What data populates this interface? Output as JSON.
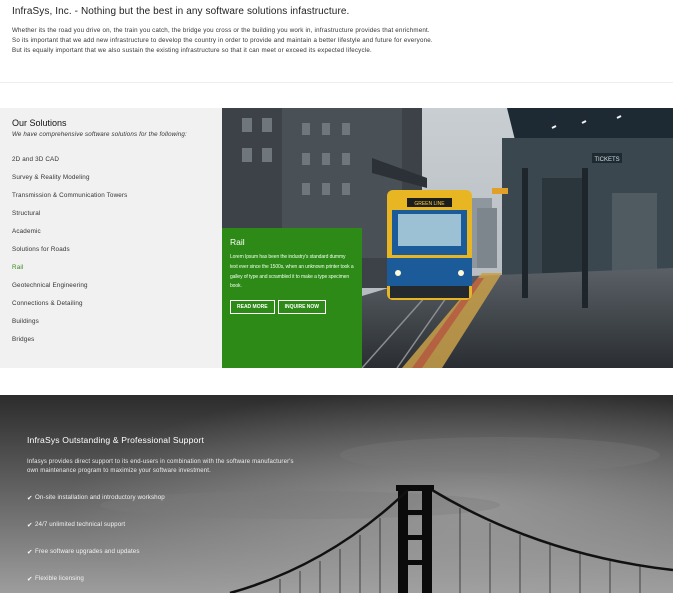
{
  "intro": {
    "title": "InfraSys, Inc. - Nothing but the best in any software solutions infastructure.",
    "lines": [
      "Whether its the road you drive on, the train you catch, the bridge you cross or the building you work in, infrastructure provides that enrichment.",
      "So its important that we add new infrastructure to develop the country in order to provide and maintain a better lifestyle and future for everyone.",
      "But its equally important that we also sustain the existing infrastructure so that it can meet or exceed its expected lifecycle."
    ]
  },
  "solutions": {
    "title": "Our Solutions",
    "subtitle": "We have comprehensive software solutions for the following:",
    "items": [
      {
        "label": "2D and 3D CAD"
      },
      {
        "label": "Survey & Reality Modeling"
      },
      {
        "label": "Transmission & Communication Towers"
      },
      {
        "label": "Structural"
      },
      {
        "label": "Academic"
      },
      {
        "label": "Solutions for Roads"
      },
      {
        "label": "Rail"
      },
      {
        "label": "Geotechnical Engineering"
      },
      {
        "label": "Connections & Detailing"
      },
      {
        "label": "Buildings"
      },
      {
        "label": "Bridges"
      }
    ],
    "active_index": 6,
    "active_color": "#3a8a1e"
  },
  "rail_card": {
    "title": "Rail",
    "text": "Lorem Ipsum has been the industry's standard dummy text ever since the 1500s, when an unknown printer took a galley of type and scrambled it to make a type specimen book.",
    "buttons": {
      "more": "READ MORE",
      "inquire": "INQUIRE NOW"
    },
    "bg_color": "#2e8a17"
  },
  "hero_signs": {
    "tickets": "TICKETS",
    "tram_destination": "GREEN LINE"
  },
  "support": {
    "title": "InfraSys Outstanding & Professional Support",
    "description": "Infasys provides direct support to its end-users in combination with the software manufacturer's own maintenance program to maximize your software investment.",
    "features": [
      {
        "label": "On-site installation and introductory workshop"
      },
      {
        "label": "24/7 unlimited technical support"
      },
      {
        "label": "Free software upgrades and updates"
      },
      {
        "label": "Flexible licensing"
      }
    ],
    "check_icon": "check-icon"
  }
}
